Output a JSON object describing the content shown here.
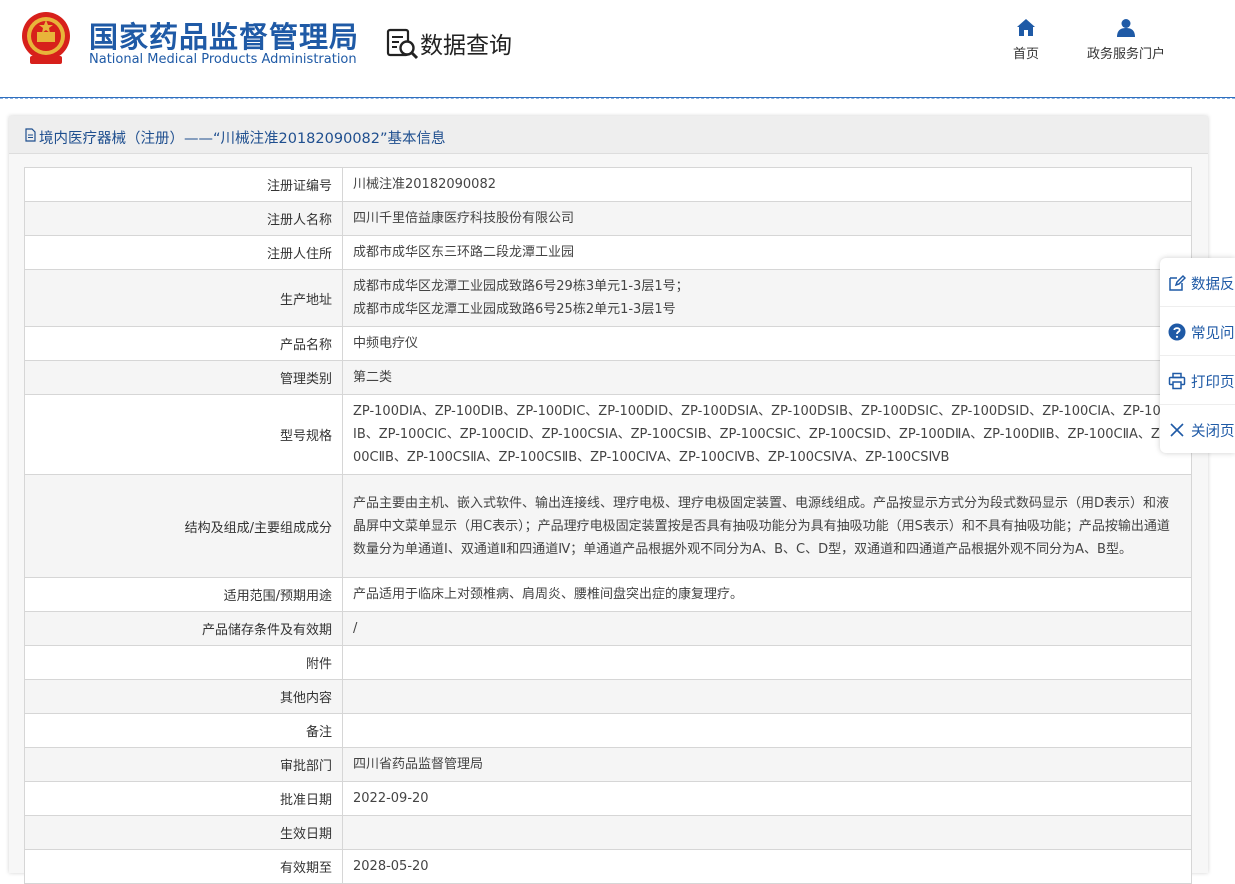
{
  "header": {
    "logo_cn": "国家药品监督管理局",
    "logo_en": "National Medical Products Administration",
    "section_title": "数据查询",
    "nav": [
      {
        "label": "首页",
        "icon": "home-icon"
      },
      {
        "label": "政务服务门户",
        "icon": "user-icon"
      }
    ]
  },
  "panel": {
    "title": "境内医疗器械（注册）——“川械注准20182090082”基本信息"
  },
  "rows": [
    {
      "label": "注册证编号",
      "value": "川械注准20182090082"
    },
    {
      "label": "注册人名称",
      "value": "四川千里倍益康医疗科技股份有限公司"
    },
    {
      "label": "注册人住所",
      "value": "成都市成华区东三环路二段龙潭工业园"
    },
    {
      "label": "生产地址",
      "value": "成都市成华区龙潭工业园成致路6号29栋3单元1-3层1号；\n成都市成华区龙潭工业园成致路6号25栋2单元1-3层1号"
    },
    {
      "label": "产品名称",
      "value": "中频电疗仪"
    },
    {
      "label": "管理类别",
      "value": "第二类"
    },
    {
      "label": "型号规格",
      "value": "ZP-100DⅠA、ZP-100DⅠB、ZP-100DⅠC、ZP-100DⅠD、ZP-100DSⅠA、ZP-100DSⅠB、ZP-100DSⅠC、ZP-100DSⅠD、ZP-100CⅠA、ZP-100CⅠB、ZP-100CⅠC、ZP-100CⅠD、ZP-100CSⅠA、ZP-100CSⅠB、ZP-100CSⅠC、ZP-100CSⅠD、ZP-100DⅡA、ZP-100DⅡB、ZP-100CⅡA、ZP-100CⅡB、ZP-100CSⅡA、ZP-100CSⅡB、ZP-100CⅣA、ZP-100CⅣB、ZP-100CSⅣA、ZP-100CSⅣB"
    },
    {
      "label": "结构及组成/主要组成成分",
      "value": "产品主要由主机、嵌入式软件、输出连接线、理疗电极、理疗电极固定装置、电源线组成。产品按显示方式分为段式数码显示（用D表示）和液晶屏中文菜单显示（用C表示）；产品理疗电极固定装置按是否具有抽吸功能分为具有抽吸功能（用S表示）和不具有抽吸功能；产品按输出通道数量分为单通道Ⅰ、双通道Ⅱ和四通道Ⅳ；单通道产品根据外观不同分为A、B、C、D型，双通道和四通道产品根据外观不同分为A、B型。"
    },
    {
      "label": "适用范围/预期用途",
      "value": "产品适用于临床上对颈椎病、肩周炎、腰椎间盘突出症的康复理疗。"
    },
    {
      "label": "产品储存条件及有效期",
      "value": "/"
    },
    {
      "label": "附件",
      "value": ""
    },
    {
      "label": "其他内容",
      "value": ""
    },
    {
      "label": "备注",
      "value": ""
    },
    {
      "label": "审批部门",
      "value": "四川省药品监督管理局"
    },
    {
      "label": "批准日期",
      "value": "2022-09-20"
    },
    {
      "label": "生效日期",
      "value": ""
    },
    {
      "label": "有效期至",
      "value": "2028-05-20"
    }
  ],
  "float_menu": [
    {
      "label": "数据反馈",
      "icon": "edit-icon"
    },
    {
      "label": "常见问题",
      "icon": "help-icon"
    },
    {
      "label": "打印页面",
      "icon": "print-icon"
    },
    {
      "label": "关闭页面",
      "icon": "close-icon"
    }
  ]
}
